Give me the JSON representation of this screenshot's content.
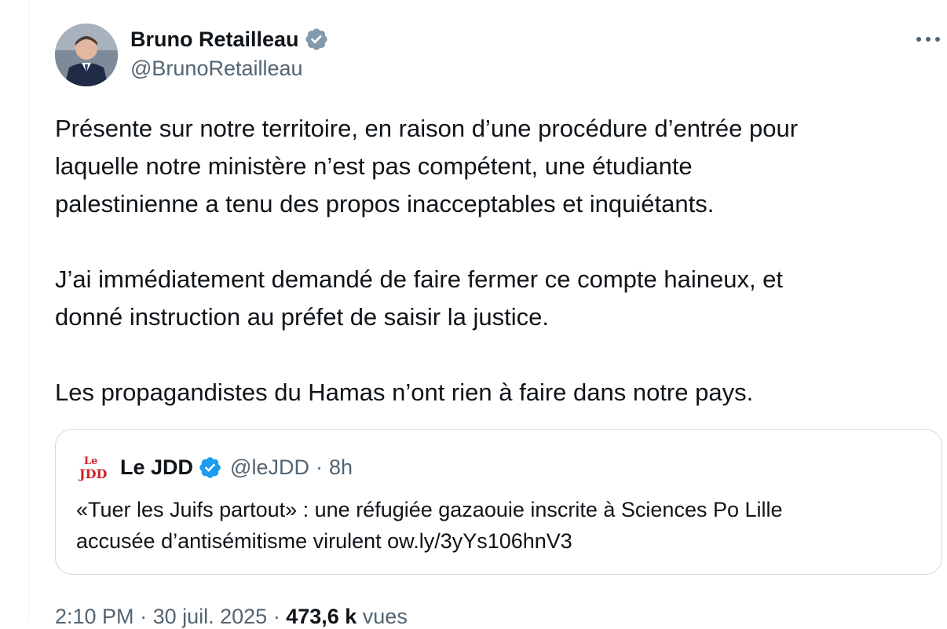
{
  "author": {
    "display_name": "Bruno Retailleau",
    "handle": "@BrunoRetailleau",
    "verified_badge_color": "#829aab"
  },
  "menu": {
    "more_icon": "more-horizontal-icon"
  },
  "tweet": {
    "paragraphs": [
      {
        "lines": [
          "Présente sur notre territoire, en raison d’une procédure d’entrée pour",
          "laquelle notre ministère n’est pas compétent, une étudiante",
          "palestinienne a tenu des propos inacceptables et inquiétants."
        ]
      },
      {
        "lines": [
          "J’ai immédiatement demandé de faire fermer ce compte haineux, et",
          "donné instruction au préfet de saisir la justice."
        ]
      },
      {
        "lines": [
          "Les propagandistes du Hamas n’ont rien à faire dans notre pays."
        ]
      }
    ]
  },
  "quote": {
    "logo_text_top": "Le",
    "logo_text_bottom": "JDD",
    "logo_color": "#d0202a",
    "name": "Le JDD",
    "verified_badge_color": "#1d9bf0",
    "handle": "@leJDD",
    "separator": "·",
    "time": "8h",
    "text_lines": [
      "«Tuer les Juifs partout» : une réfugiée gazaouie inscrite à Sciences Po Lille",
      "accusée d’antisémitisme virulent ow.ly/3yYs106hnV3"
    ]
  },
  "meta": {
    "time": "2:10 PM",
    "separator_1": " · ",
    "date": "30 juil. 2025",
    "separator_2": " · ",
    "views_count": "473,6 k",
    "views_label": " vues"
  },
  "colors": {
    "text_primary": "#0f1419",
    "text_secondary": "#536471",
    "border": "#cfd9de"
  }
}
